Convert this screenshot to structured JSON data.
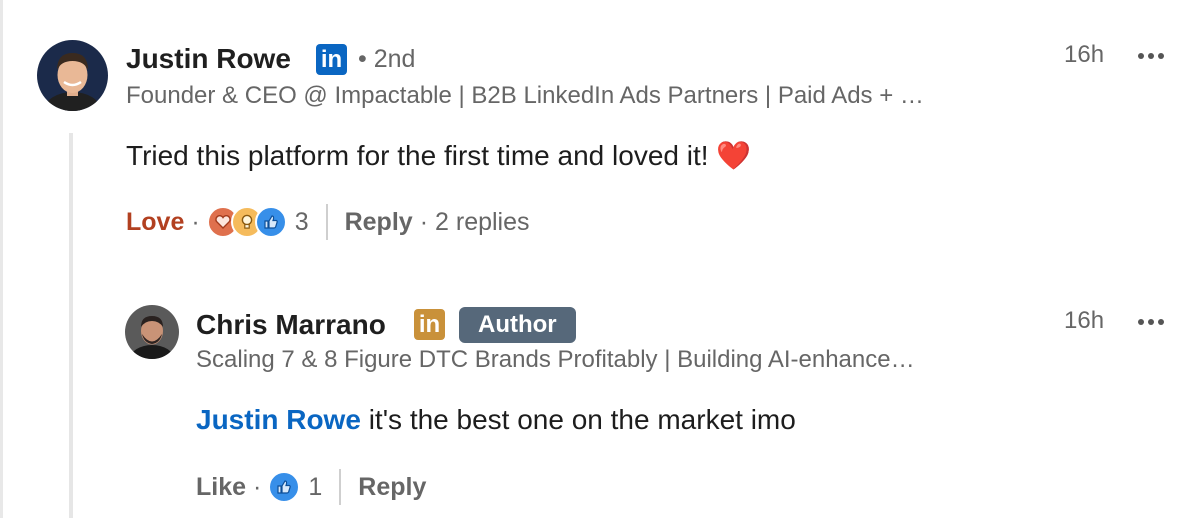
{
  "comment": {
    "author": "Justin Rowe",
    "linkedin_badge": "in",
    "degree": "• 2nd",
    "headline": "Founder & CEO @ Impactable | B2B LinkedIn Ads Partners | Paid Ads + …",
    "time": "16h",
    "text": "Tried this platform for the first time and loved it!",
    "emoji": "❤️",
    "reaction_label": "Love",
    "reaction_count": "3",
    "reaction_icons": [
      "heart-icon",
      "lightbulb-icon",
      "thumbs-up-icon"
    ],
    "reply_label": "Reply",
    "replies_count": "2 replies"
  },
  "reply": {
    "author": "Chris Marrano",
    "linkedin_badge": "in",
    "author_badge": "Author",
    "headline": "Scaling 7 & 8 Figure DTC Brands Profitably | Building AI-enhance…",
    "time": "16h",
    "mention": "Justin Rowe",
    "text": "it's the best one on the market imo",
    "like_label": "Like",
    "reaction_count": "1",
    "reaction_icons": [
      "thumbs-up-icon"
    ],
    "reply_label": "Reply"
  },
  "colors": {
    "linkedin_blue": "#0a66c2",
    "linkedin_gold": "#c9913a",
    "love_red": "#b24020",
    "author_badge_bg": "#56687a"
  }
}
